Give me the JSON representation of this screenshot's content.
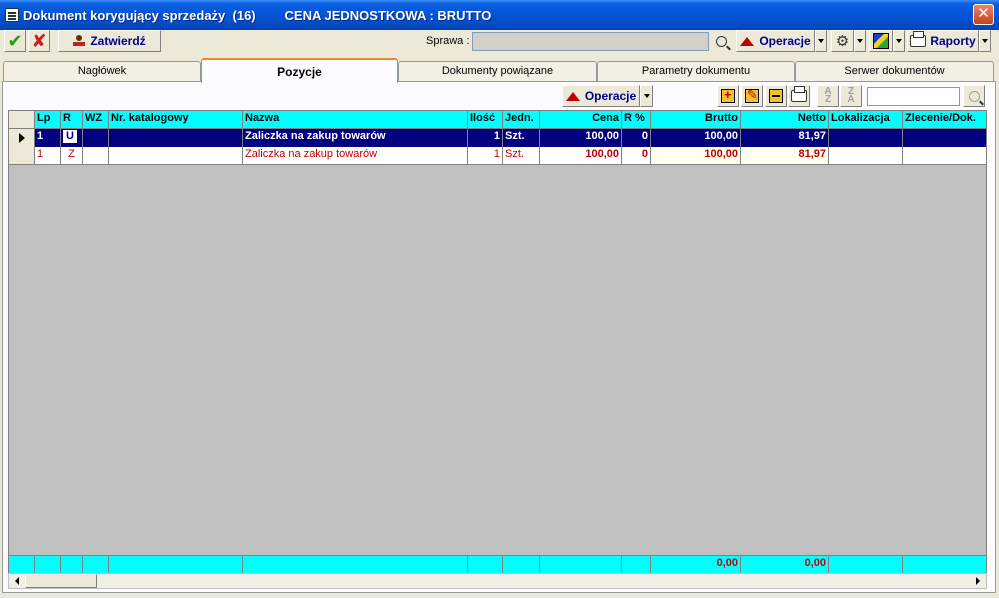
{
  "window": {
    "title": "Dokument korygujący sprzedaży  (16)        CENA JEDNOSTKOWA : BRUTTO",
    "close_glyph": "✕"
  },
  "toolbar": {
    "approve_icon": "check-icon",
    "cancel_icon": "x-icon",
    "confirm_label": "Zatwierdź",
    "sprawa_label": "Sprawa :",
    "sprawa_value": "",
    "operacje_label": "Operacje",
    "raporty_label": "Raporty",
    "colors": {
      "accent_text": "#00008b",
      "triangle": "#c00000"
    }
  },
  "tabs": [
    {
      "label": "Nagłówek",
      "active": false
    },
    {
      "label": "Pozycje",
      "active": true
    },
    {
      "label": "Dokumenty powiązane",
      "active": false
    },
    {
      "label": "Parametry dokumentu",
      "active": false
    },
    {
      "label": "Serwer dokumentów",
      "active": false
    }
  ],
  "grid_toolbar": {
    "operacje_label": "Operacje",
    "icons": [
      "add-icon",
      "edit-icon",
      "delete-icon",
      "print-icon",
      "sort-asc-icon",
      "sort-desc-icon",
      "search-icon"
    ],
    "search_value": ""
  },
  "grid": {
    "columns": [
      "Lp",
      "R",
      "WZ",
      "Nr. katalogowy",
      "Nazwa",
      "Ilość",
      "Jedn.",
      "Cena",
      "R %",
      "Brutto",
      "Netto",
      "Lokalizacja",
      "Zlecenie/Dok."
    ],
    "rows": [
      {
        "lp": "1",
        "r": "U",
        "wz": "",
        "nr_katalogowy": "",
        "nazwa": "Zaliczka na zakup towarów",
        "ilosc": "1",
        "jedn": "Szt.",
        "cena": "100,00",
        "rabat": "0",
        "brutto": "100,00",
        "netto": "81,97",
        "lokalizacja": "",
        "zlecenie": "",
        "selected": true
      },
      {
        "lp": "1",
        "r": "Z",
        "wz": "",
        "nr_katalogowy": "",
        "nazwa": "Zaliczka na zakup towarów",
        "ilosc": "1",
        "jedn": "Szt.",
        "cena": "100,00",
        "rabat": "0",
        "brutto": "100,00",
        "netto": "81,97",
        "lokalizacja": "",
        "zlecenie": "",
        "selected": false
      }
    ],
    "footer": {
      "brutto": "0,00",
      "netto": "0,00"
    },
    "colors": {
      "header_bg": "#00ffff",
      "selected_bg": "#000080",
      "correction_text": "#c00000"
    }
  }
}
